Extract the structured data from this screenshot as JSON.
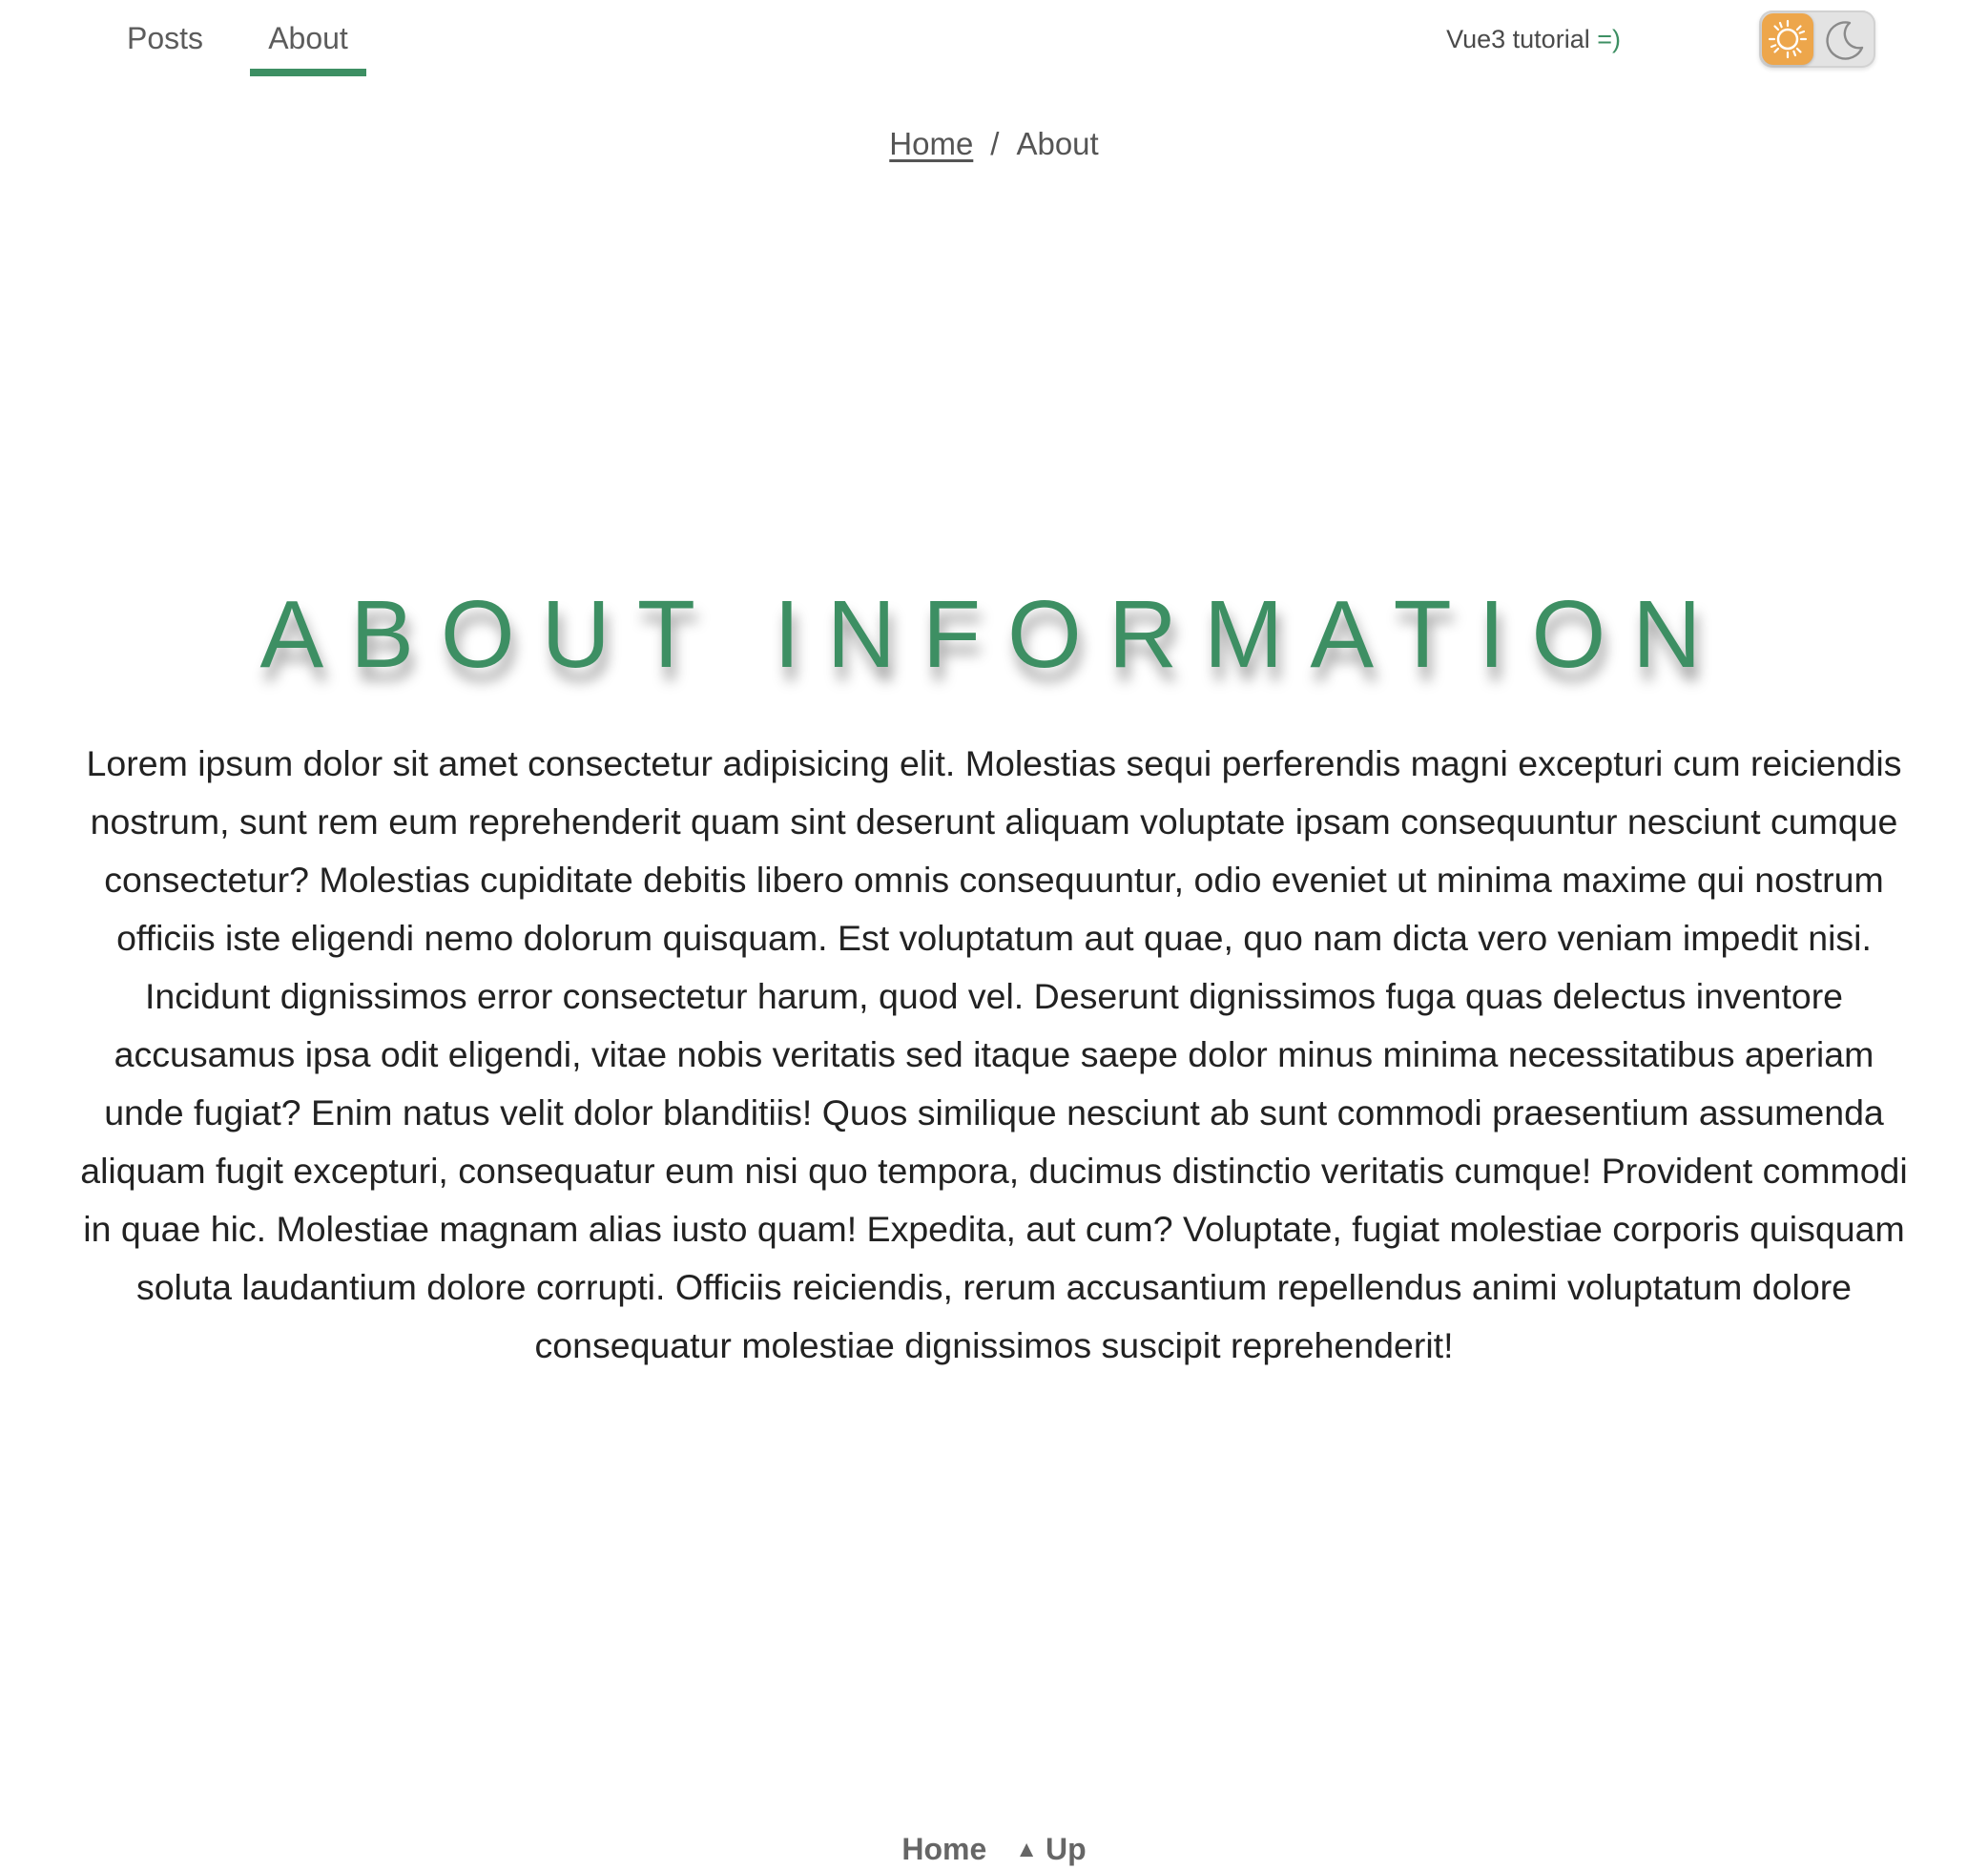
{
  "nav": {
    "tabs": [
      {
        "label": "Posts",
        "active": false
      },
      {
        "label": "About",
        "active": true
      }
    ],
    "brand_text": "Vue3 tutorial",
    "brand_smile": "=)",
    "theme_toggle": {
      "icons": [
        "sun-icon",
        "moon-icon"
      ],
      "mode": "light"
    }
  },
  "breadcrumb": {
    "home": "Home",
    "separator": "/",
    "current": "About"
  },
  "main": {
    "title": "ABOUT INFORMATION",
    "body": "Lorem ipsum dolor sit amet consectetur adipisicing elit. Molestias sequi perferendis magni excepturi cum reiciendis nostrum, sunt rem eum reprehenderit quam sint deserunt aliquam voluptate ipsam consequuntur nesciunt cumque consectetur? Molestias cupiditate debitis libero omnis consequuntur, odio eveniet ut minima maxime qui nostrum officiis iste eligendi nemo dolorum quisquam. Est voluptatum aut quae, quo nam dicta vero veniam impedit nisi. Incidunt dignissimos error consectetur harum, quod vel. Deserunt dignissimos fuga quas delectus inventore accusamus ipsa odit eligendi, vitae nobis veritatis sed itaque saepe dolor minus minima necessitatibus aperiam unde fugiat? Enim natus velit dolor blanditiis! Quos similique nesciunt ab sunt commodi praesentium assumenda aliquam fugit excepturi, consequatur eum nisi quo tempora, ducimus distinctio veritatis cumque! Provident commodi in quae hic. Molestiae magnam alias iusto quam! Expedita, aut cum? Voluptate, fugiat molestiae corporis quisquam soluta laudantium dolore corrupti. Officiis reiciendis, rerum accusantium repellendus animi voluptatum dolore consequatur molestiae dignissimos suscipit reprehenderit!"
  },
  "footer": {
    "home": "Home",
    "up": "Up",
    "up_icon": "triangle-up-icon"
  },
  "colors": {
    "accent": "#3d8f63",
    "sun": "#eda64b"
  }
}
